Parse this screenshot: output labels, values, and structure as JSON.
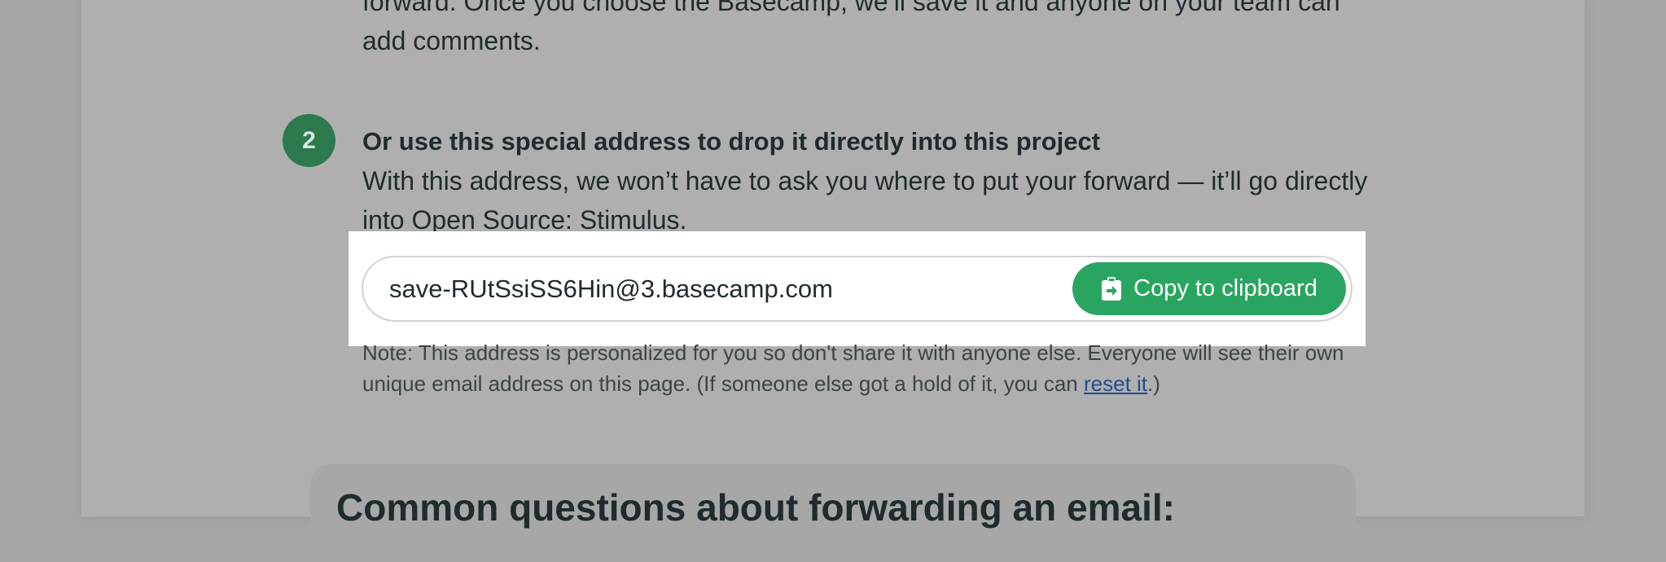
{
  "previous_step": {
    "text": "forward. Once you choose the Basecamp, we’ll save it and anyone on your team can add comments."
  },
  "step2": {
    "number": "2",
    "title": "Or use this special address to drop it directly into this project",
    "description": "With this address, we won’t have to ask you where to put your forward — it’ll go directly into Open Source: Stimulus."
  },
  "address": {
    "value": "save-RUtSsiSS6Hin@3.basecamp.com",
    "copy_label": "Copy to clipboard",
    "copy_icon": "clipboard-arrow-icon"
  },
  "note": {
    "text_before": "Note: This address is personalized for you so don't share it with anyone else. Everyone will see their own unique email address on this page. (If someone else got a hold of it, you can ",
    "link_label": "reset it",
    "text_after": ".)"
  },
  "faq": {
    "title": "Common questions about forwarding an email:"
  },
  "colors": {
    "step_badge": "#2c7a4e",
    "copy_button": "#2aa561",
    "link": "#1e4f8f"
  }
}
